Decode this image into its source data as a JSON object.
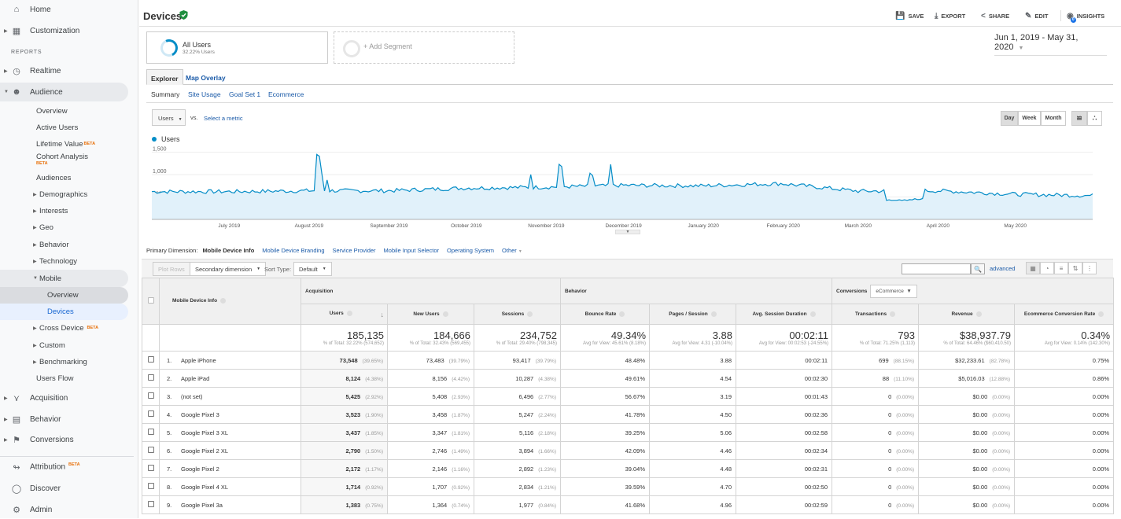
{
  "sidebar": {
    "home": "Home",
    "customization": "Customization",
    "reports_heading": "REPORTS",
    "realtime": "Realtime",
    "audience": "Audience",
    "audience_items": [
      {
        "label": "Overview"
      },
      {
        "label": "Active Users"
      },
      {
        "label": "Lifetime Value",
        "badge": "BETA"
      },
      {
        "label": "Cohort Analysis",
        "badge": "BETA"
      },
      {
        "label": "Audiences"
      },
      {
        "label": "Demographics"
      },
      {
        "label": "Interests"
      },
      {
        "label": "Geo"
      },
      {
        "label": "Behavior"
      },
      {
        "label": "Technology"
      },
      {
        "label": "Mobile"
      },
      {
        "label": "Overview"
      },
      {
        "label": "Devices"
      },
      {
        "label": "Cross Device",
        "badge": "BETA"
      },
      {
        "label": "Custom"
      },
      {
        "label": "Benchmarking"
      },
      {
        "label": "Users Flow"
      }
    ],
    "acquisition": "Acquisition",
    "behavior": "Behavior",
    "conversions": "Conversions",
    "attribution": "Attribution",
    "attribution_badge": "BETA",
    "discover": "Discover",
    "admin": "Admin"
  },
  "header": {
    "title": "Devices",
    "actions": {
      "save": "SAVE",
      "export": "EXPORT",
      "share": "SHARE",
      "edit": "EDIT",
      "insights": "INSIGHTS"
    },
    "insights_badge": "0"
  },
  "segments": {
    "all_users": "All Users",
    "all_users_sub": "32.22% Users",
    "add_segment": "+ Add Segment"
  },
  "date_range": "Jun 1, 2019 - May 31, 2020",
  "tabs": [
    "Explorer",
    "Map Overlay"
  ],
  "subtabs": [
    "Summary",
    "Site Usage",
    "Goal Set 1",
    "Ecommerce"
  ],
  "chart_controls": {
    "metric": "Users",
    "vs": "vs.",
    "select_metric": "Select a metric",
    "granularity": [
      "Day",
      "Week",
      "Month"
    ],
    "active_granularity": "Day"
  },
  "chart_data": {
    "type": "area",
    "legend": [
      "Users"
    ],
    "color": "#058dc7",
    "y_ticks": [
      "1,500",
      "1,000",
      "500"
    ],
    "ylim": [
      0,
      1650
    ],
    "x_ticks": [
      "July 2019",
      "August 2019",
      "September 2019",
      "October 2019",
      "November 2019",
      "December 2019",
      "January 2020",
      "February 2020",
      "March 2020",
      "April 2020",
      "May 2020"
    ],
    "x_range": [
      "Jun 1, 2019",
      "May 31, 2020"
    ],
    "series_approx": [
      {
        "period": "Jun 2019",
        "typical": 620
      },
      {
        "period": "Jul 2019",
        "typical": 640
      },
      {
        "period": "Aug 2019 early",
        "peak": 1450
      },
      {
        "period": "Aug 2019",
        "typical": 700
      },
      {
        "period": "Sep 2019",
        "typical": 720
      },
      {
        "period": "Oct 2019",
        "typical": 760,
        "peak": 980
      },
      {
        "period": "Nov 2019",
        "typical": 750,
        "peak": 1200
      },
      {
        "period": "Dec 2019",
        "typical": 800,
        "peak": 1180
      },
      {
        "period": "Jan 2020",
        "typical": 630
      },
      {
        "period": "Feb 2020",
        "typical": 640
      },
      {
        "period": "Mar 2020",
        "typical": 560,
        "low": 400
      },
      {
        "period": "Apr 2020",
        "typical": 530
      },
      {
        "period": "May 2020",
        "typical": 640
      }
    ]
  },
  "primary_dimension": {
    "label": "Primary Dimension:",
    "current": "Mobile Device Info",
    "options": [
      "Mobile Device Branding",
      "Service Provider",
      "Mobile Input Selector",
      "Operating System",
      "Other"
    ]
  },
  "table_toolbar": {
    "plot_rows": "Plot Rows",
    "secondary_dimension": "Secondary dimension",
    "sort_type_label": "Sort Type:",
    "sort_type": "Default",
    "search_placeholder": "",
    "advanced": "advanced"
  },
  "table": {
    "dimension_header": "Mobile Device Info",
    "groups": {
      "acquisition": "Acquisition",
      "behavior": "Behavior",
      "conversions": "Conversions",
      "conversions_select": "eCommerce"
    },
    "columns": [
      "Users",
      "New Users",
      "Sessions",
      "Bounce Rate",
      "Pages / Session",
      "Avg. Session Duration",
      "Transactions",
      "Revenue",
      "Ecommerce Conversion Rate"
    ],
    "totals": [
      {
        "value": "185,135",
        "sub": "% of Total: 32.22% (574,652)"
      },
      {
        "value": "184,666",
        "sub": "% of Total: 32.43% (569,455)"
      },
      {
        "value": "234,752",
        "sub": "% of Total: 29.40% (798,345)"
      },
      {
        "value": "49.34%",
        "sub": "Avg for View: 45.61% (8.18%)"
      },
      {
        "value": "3.88",
        "sub": "Avg for View: 4.31 (-10.04%)"
      },
      {
        "value": "00:02:11",
        "sub": "Avg for View: 00:02:53 (-24.55%)"
      },
      {
        "value": "793",
        "sub": "% of Total: 71.25% (1,113)"
      },
      {
        "value": "$38,937.79",
        "sub": "% of Total: 64.46% ($60,410.50)"
      },
      {
        "value": "0.34%",
        "sub": "Avg for View: 0.14% (142.30%)"
      }
    ],
    "rows": [
      {
        "rank": "1.",
        "device": "Apple iPhone",
        "users": "73,548",
        "users_pct": "(39.65%)",
        "new_users": "73,483",
        "new_users_pct": "(39.79%)",
        "sessions": "93,417",
        "sessions_pct": "(39.79%)",
        "bounce": "48.48%",
        "pps": "3.88",
        "dur": "00:02:11",
        "tx": "699",
        "tx_pct": "(88.15%)",
        "rev": "$32,233.61",
        "rev_pct": "(82.78%)",
        "conv": "0.75%"
      },
      {
        "rank": "2.",
        "device": "Apple iPad",
        "users": "8,124",
        "users_pct": "(4.38%)",
        "new_users": "8,156",
        "new_users_pct": "(4.42%)",
        "sessions": "10,287",
        "sessions_pct": "(4.38%)",
        "bounce": "49.61%",
        "pps": "4.54",
        "dur": "00:02:30",
        "tx": "88",
        "tx_pct": "(11.10%)",
        "rev": "$5,016.03",
        "rev_pct": "(12.88%)",
        "conv": "0.86%"
      },
      {
        "rank": "3.",
        "device": "(not set)",
        "users": "5,425",
        "users_pct": "(2.92%)",
        "new_users": "5,408",
        "new_users_pct": "(2.93%)",
        "sessions": "6,496",
        "sessions_pct": "(2.77%)",
        "bounce": "56.67%",
        "pps": "3.19",
        "dur": "00:01:43",
        "tx": "0",
        "tx_pct": "(0.00%)",
        "rev": "$0.00",
        "rev_pct": "(0.00%)",
        "conv": "0.00%"
      },
      {
        "rank": "4.",
        "device": "Google Pixel 3",
        "users": "3,523",
        "users_pct": "(1.90%)",
        "new_users": "3,458",
        "new_users_pct": "(1.87%)",
        "sessions": "5,247",
        "sessions_pct": "(2.24%)",
        "bounce": "41.78%",
        "pps": "4.50",
        "dur": "00:02:36",
        "tx": "0",
        "tx_pct": "(0.00%)",
        "rev": "$0.00",
        "rev_pct": "(0.00%)",
        "conv": "0.00%"
      },
      {
        "rank": "5.",
        "device": "Google Pixel 3 XL",
        "users": "3,437",
        "users_pct": "(1.85%)",
        "new_users": "3,347",
        "new_users_pct": "(1.81%)",
        "sessions": "5,116",
        "sessions_pct": "(2.18%)",
        "bounce": "39.25%",
        "pps": "5.06",
        "dur": "00:02:58",
        "tx": "0",
        "tx_pct": "(0.00%)",
        "rev": "$0.00",
        "rev_pct": "(0.00%)",
        "conv": "0.00%"
      },
      {
        "rank": "6.",
        "device": "Google Pixel 2 XL",
        "users": "2,790",
        "users_pct": "(1.50%)",
        "new_users": "2,746",
        "new_users_pct": "(1.49%)",
        "sessions": "3,894",
        "sessions_pct": "(1.66%)",
        "bounce": "42.09%",
        "pps": "4.46",
        "dur": "00:02:34",
        "tx": "0",
        "tx_pct": "(0.00%)",
        "rev": "$0.00",
        "rev_pct": "(0.00%)",
        "conv": "0.00%"
      },
      {
        "rank": "7.",
        "device": "Google Pixel 2",
        "users": "2,172",
        "users_pct": "(1.17%)",
        "new_users": "2,146",
        "new_users_pct": "(1.16%)",
        "sessions": "2,892",
        "sessions_pct": "(1.23%)",
        "bounce": "39.04%",
        "pps": "4.48",
        "dur": "00:02:31",
        "tx": "0",
        "tx_pct": "(0.00%)",
        "rev": "$0.00",
        "rev_pct": "(0.00%)",
        "conv": "0.00%"
      },
      {
        "rank": "8.",
        "device": "Google Pixel 4 XL",
        "users": "1,714",
        "users_pct": "(0.92%)",
        "new_users": "1,707",
        "new_users_pct": "(0.92%)",
        "sessions": "2,834",
        "sessions_pct": "(1.21%)",
        "bounce": "39.59%",
        "pps": "4.70",
        "dur": "00:02:50",
        "tx": "0",
        "tx_pct": "(0.00%)",
        "rev": "$0.00",
        "rev_pct": "(0.00%)",
        "conv": "0.00%"
      },
      {
        "rank": "9.",
        "device": "Google Pixel 3a",
        "users": "1,383",
        "users_pct": "(0.75%)",
        "new_users": "1,364",
        "new_users_pct": "(0.74%)",
        "sessions": "1,977",
        "sessions_pct": "(0.84%)",
        "bounce": "41.68%",
        "pps": "4.96",
        "dur": "00:02:59",
        "tx": "0",
        "tx_pct": "(0.00%)",
        "rev": "$0.00",
        "rev_pct": "(0.00%)",
        "conv": "0.00%"
      }
    ]
  }
}
